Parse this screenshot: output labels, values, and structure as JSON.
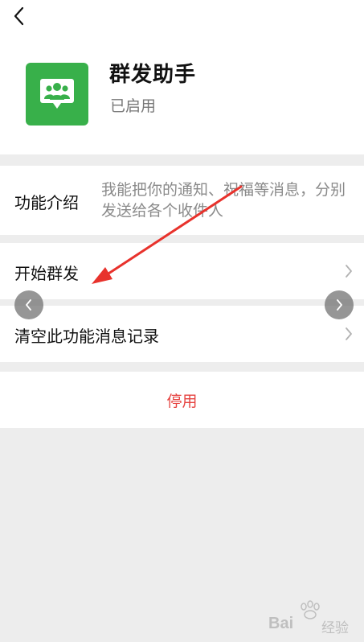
{
  "header": {
    "app_name": "群发助手",
    "status": "已启用",
    "icon": "group-people-icon"
  },
  "rows": {
    "intro_label": "功能介绍",
    "intro_text": "我能把你的通知、祝福等消息，分别发送给各个收件人",
    "start_label": "开始群发",
    "clear_label": "清空此功能消息记录"
  },
  "actions": {
    "disable_label": "停用"
  },
  "watermark": {
    "brand_text": "Bai",
    "brand_suffix": "经验"
  },
  "colors": {
    "icon_green": "#38b04a",
    "danger_red": "#e64340",
    "annotation_red": "#e8322c",
    "background": "#ededed"
  }
}
